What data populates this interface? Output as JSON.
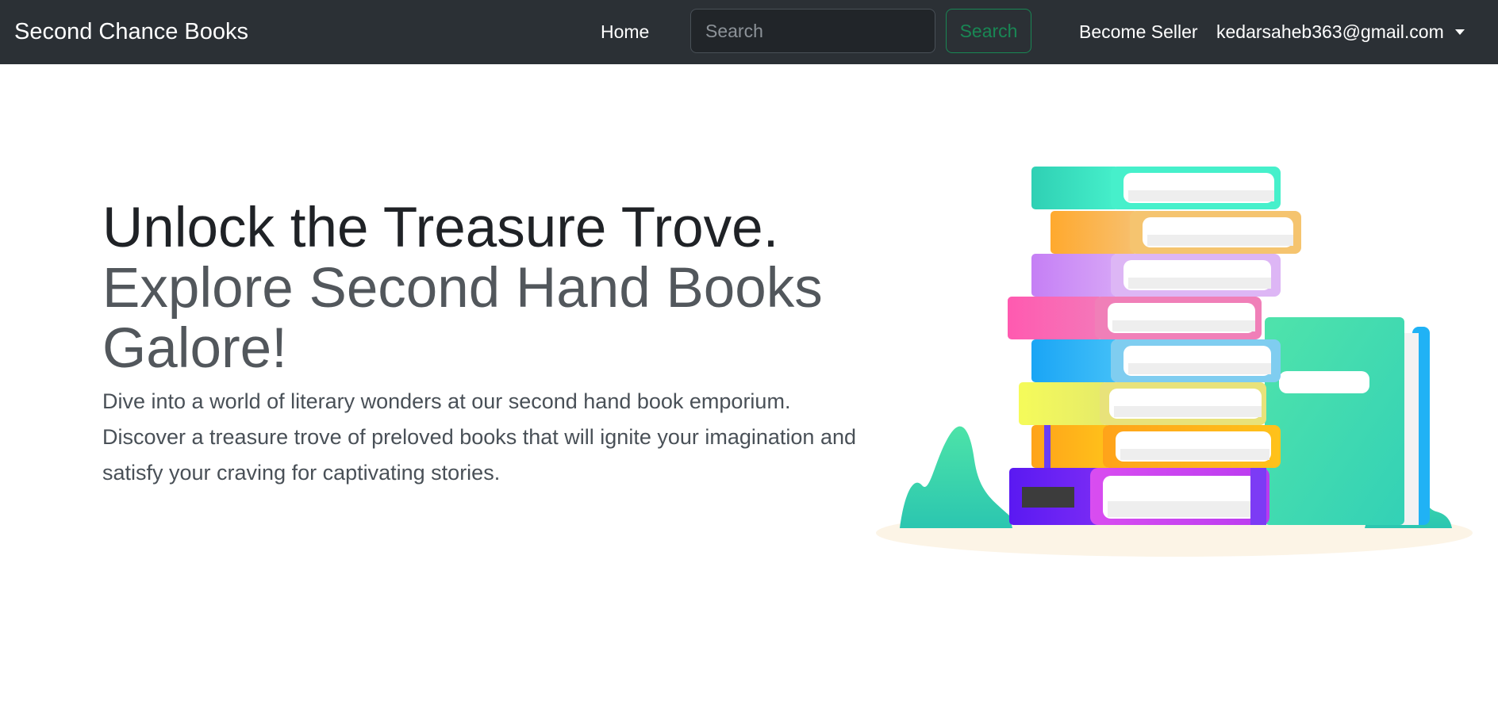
{
  "navbar": {
    "brand": "Second Chance Books",
    "home_label": "Home",
    "search_placeholder": "Search",
    "search_button_label": "Search",
    "become_seller_label": "Become Seller",
    "user_email": "kedarsaheb363@gmail.com",
    "background_color": "#2b3035",
    "search_button_color": "#198754"
  },
  "hero": {
    "headline_line1": "Unlock the Treasure Trove.",
    "headline_line2": "Explore Second Hand Books Galore!",
    "lead": "Dive into a world of literary wonders at our second hand book emporium. Discover a treasure trove of preloved books that will ignite your imagination and satisfy your craving for captivating stories.",
    "illustration_icon": "stack-of-books-illustration"
  }
}
